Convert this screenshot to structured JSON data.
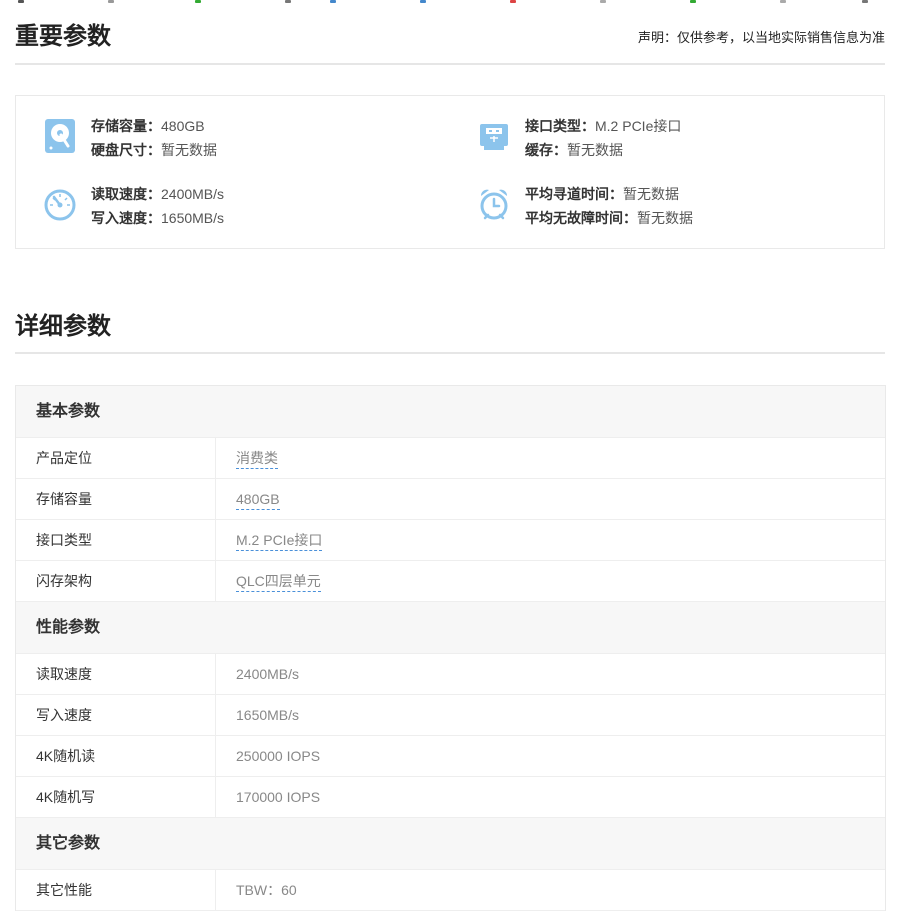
{
  "important": {
    "title": "重要参数",
    "note": "声明：仅供参考，以当地实际销售信息为准",
    "items": [
      {
        "icon": "hard-disk-icon",
        "l1_label": "存储容量：",
        "l1_value": "480GB",
        "l2_label": "硬盘尺寸：",
        "l2_value": "暂无数据"
      },
      {
        "icon": "usb-interface-icon",
        "l1_label": "接口类型：",
        "l1_value": "M.2 PCIe接口",
        "l2_label": "缓存：",
        "l2_value": "暂无数据"
      },
      {
        "icon": "speed-gauge-icon",
        "l1_label": "读取速度：",
        "l1_value": "2400MB/s",
        "l2_label": "写入速度：",
        "l2_value": "1650MB/s"
      },
      {
        "icon": "alarm-clock-icon",
        "l1_label": "平均寻道时间：",
        "l1_value": "暂无数据",
        "l2_label": "平均无故障时间：",
        "l2_value": "暂无数据"
      }
    ]
  },
  "detail": {
    "title": "详细参数",
    "groups": [
      {
        "name": "基本参数",
        "rows": [
          {
            "k": "产品定位",
            "v": "消费类"
          },
          {
            "k": "存储容量",
            "v": "480GB"
          },
          {
            "k": "接口类型",
            "v": "M.2 PCIe接口"
          },
          {
            "k": "闪存架构",
            "v": "QLC四层单元"
          }
        ]
      },
      {
        "name": "性能参数",
        "rows": [
          {
            "k": "读取速度",
            "v": "2400MB/s"
          },
          {
            "k": "写入速度",
            "v": "1650MB/s"
          },
          {
            "k": "4K随机读",
            "v": "250000 IOPS"
          },
          {
            "k": "4K随机写",
            "v": "170000 IOPS"
          }
        ]
      },
      {
        "name": "其它参数",
        "rows": [
          {
            "k": "其它性能",
            "v": "TBW：60"
          }
        ]
      }
    ]
  },
  "colors": {
    "icon_blue": "#8cc4ec",
    "link_underline": "#4a90d9"
  }
}
